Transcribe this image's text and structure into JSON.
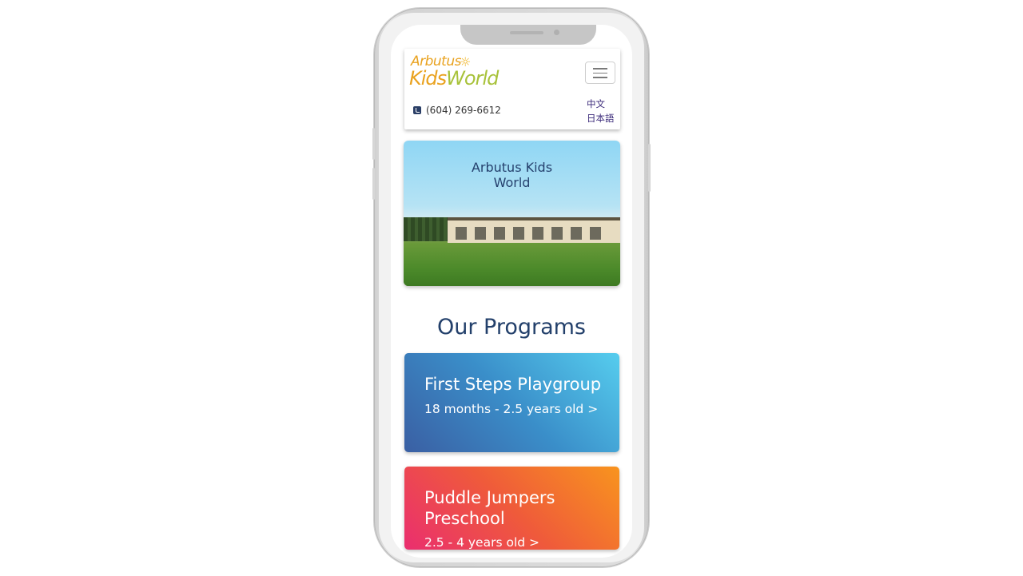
{
  "header": {
    "logo_line1": "Arbutus",
    "logo_line2_a": "Kids",
    "logo_line2_b": "World",
    "menu_icon": "hamburger-icon",
    "phone_icon": "phone-icon",
    "phone": "(604) 269-6612",
    "lang_chinese": "中文",
    "lang_japanese": "日本語"
  },
  "hero": {
    "title_line1": "Arbutus Kids",
    "title_line2": "World"
  },
  "programs": {
    "heading": "Our Programs",
    "items": [
      {
        "title": "First Steps Playgroup",
        "subtitle": "18 months - 2.5 years old >"
      },
      {
        "title_line1": "Puddle Jumpers",
        "title_line2": "Preschool",
        "subtitle": "2.5 - 4 years old >"
      }
    ]
  },
  "colors": {
    "brand_navy": "#23406b",
    "logo_orange": "#e9a21f",
    "card_blue_start": "#56cdee",
    "card_blue_end": "#3a5fa3",
    "card_orange_start": "#f8941e",
    "card_orange_end": "#ea2e6f"
  }
}
